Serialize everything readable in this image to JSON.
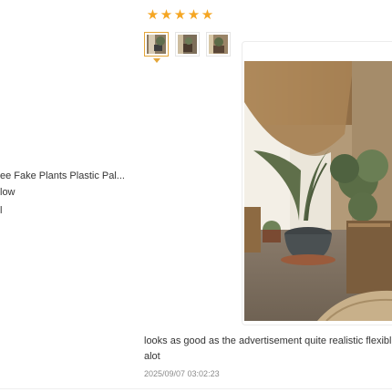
{
  "rating": {
    "stars": 5,
    "max": 5,
    "color": "#f5a623"
  },
  "product": {
    "title": "ee Fake Plants Plastic Pal...",
    "variant": "low",
    "extra": "l"
  },
  "review": {
    "text": "looks as good as the advertisement quite realistic flexible (",
    "text_line2": "alot",
    "date": "2025/09/07 03:02:23"
  },
  "gallery": {
    "thumbnail_count": 3,
    "selected_index": 0,
    "accent_color": "#e3a63a"
  },
  "icons": [
    "star-icon",
    "chevron-down-icon"
  ]
}
